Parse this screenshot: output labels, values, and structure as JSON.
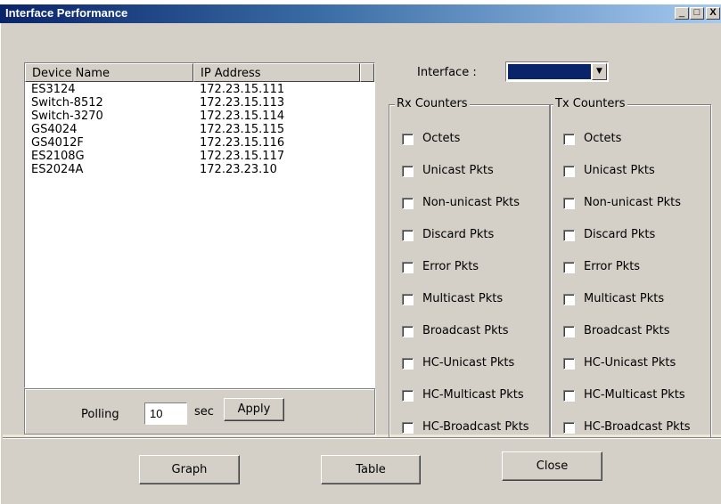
{
  "window": {
    "title": "Interface Performance",
    "minimize": "_",
    "maximize": "□",
    "close": "X"
  },
  "device_table": {
    "columns": [
      "Device Name",
      "IP Address"
    ],
    "rows": [
      [
        "ES3124",
        "172.23.15.111"
      ],
      [
        "Switch-8512",
        "172.23.15.113"
      ],
      [
        "Switch-3270",
        "172.23.15.114"
      ],
      [
        "GS4024",
        "172.23.15.115"
      ],
      [
        "GS4012F",
        "172.23.15.116"
      ],
      [
        "ES2108G",
        "172.23.15.117"
      ],
      [
        "ES2024A",
        "172.23.23.10"
      ]
    ]
  },
  "polling": {
    "label": "Polling",
    "value": "10",
    "unit": "sec",
    "apply": "Apply"
  },
  "interface": {
    "label": "Interface :",
    "selected": "",
    "dropdown_icon": "chevron-down-icon",
    "selected_color": "#0a246a"
  },
  "rx": {
    "title": "Rx Counters",
    "items": [
      "Octets",
      "Unicast Pkts",
      "Non-unicast Pkts",
      "Discard Pkts",
      "Error Pkts",
      "Multicast Pkts",
      "Broadcast Pkts",
      "HC-Unicast Pkts",
      "HC-Multicast Pkts",
      "HC-Broadcast Pkts"
    ],
    "checked": [
      false,
      false,
      false,
      false,
      false,
      false,
      false,
      false,
      false,
      false
    ]
  },
  "tx": {
    "title": "Tx Counters",
    "items": [
      "Octets",
      "Unicast Pkts",
      "Non-unicast Pkts",
      "Discard Pkts",
      "Error Pkts",
      "Multicast Pkts",
      "Broadcast Pkts",
      "HC-Unicast Pkts",
      "HC-Multicast Pkts",
      "HC-Broadcast Pkts"
    ],
    "checked": [
      false,
      false,
      false,
      false,
      false,
      false,
      false,
      false,
      false,
      false
    ]
  },
  "buttons": {
    "graph": "Graph",
    "table": "Table",
    "close": "Close"
  }
}
